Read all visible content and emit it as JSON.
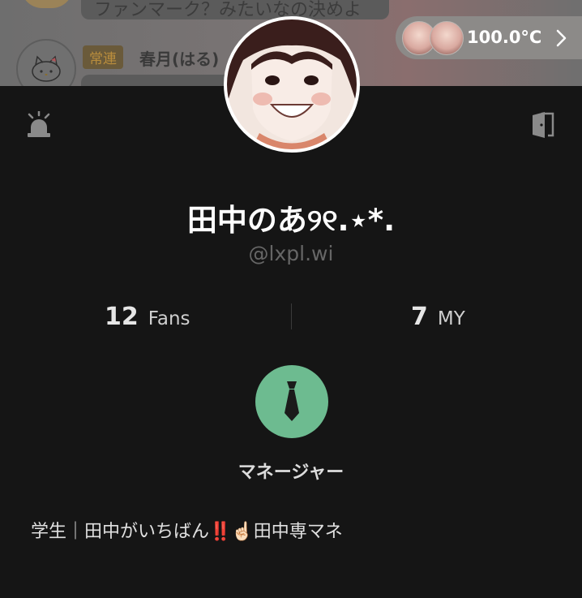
{
  "chat": {
    "top_message": "ファンマーク？みたいなの決めよ",
    "member_badge": "常連",
    "member_name": "春月(はる)"
  },
  "temperature": {
    "value": "100.0°C",
    "icon": "chevron-right-icon"
  },
  "profile": {
    "name": "田中のあ୨୧.⋆*.",
    "handle": "@lxpl.wi",
    "fans_count": "12",
    "fans_label": "Fans",
    "my_count": "7",
    "my_label": "MY",
    "role_label": "マネージャー",
    "role_icon": "necktie-icon",
    "role_color": "#6dbb90",
    "bio": "学生｜田中がいちばん‼️☝🏻田中専マネ"
  },
  "icons": {
    "left": "alarm-light-icon",
    "right": "exit-door-icon"
  }
}
